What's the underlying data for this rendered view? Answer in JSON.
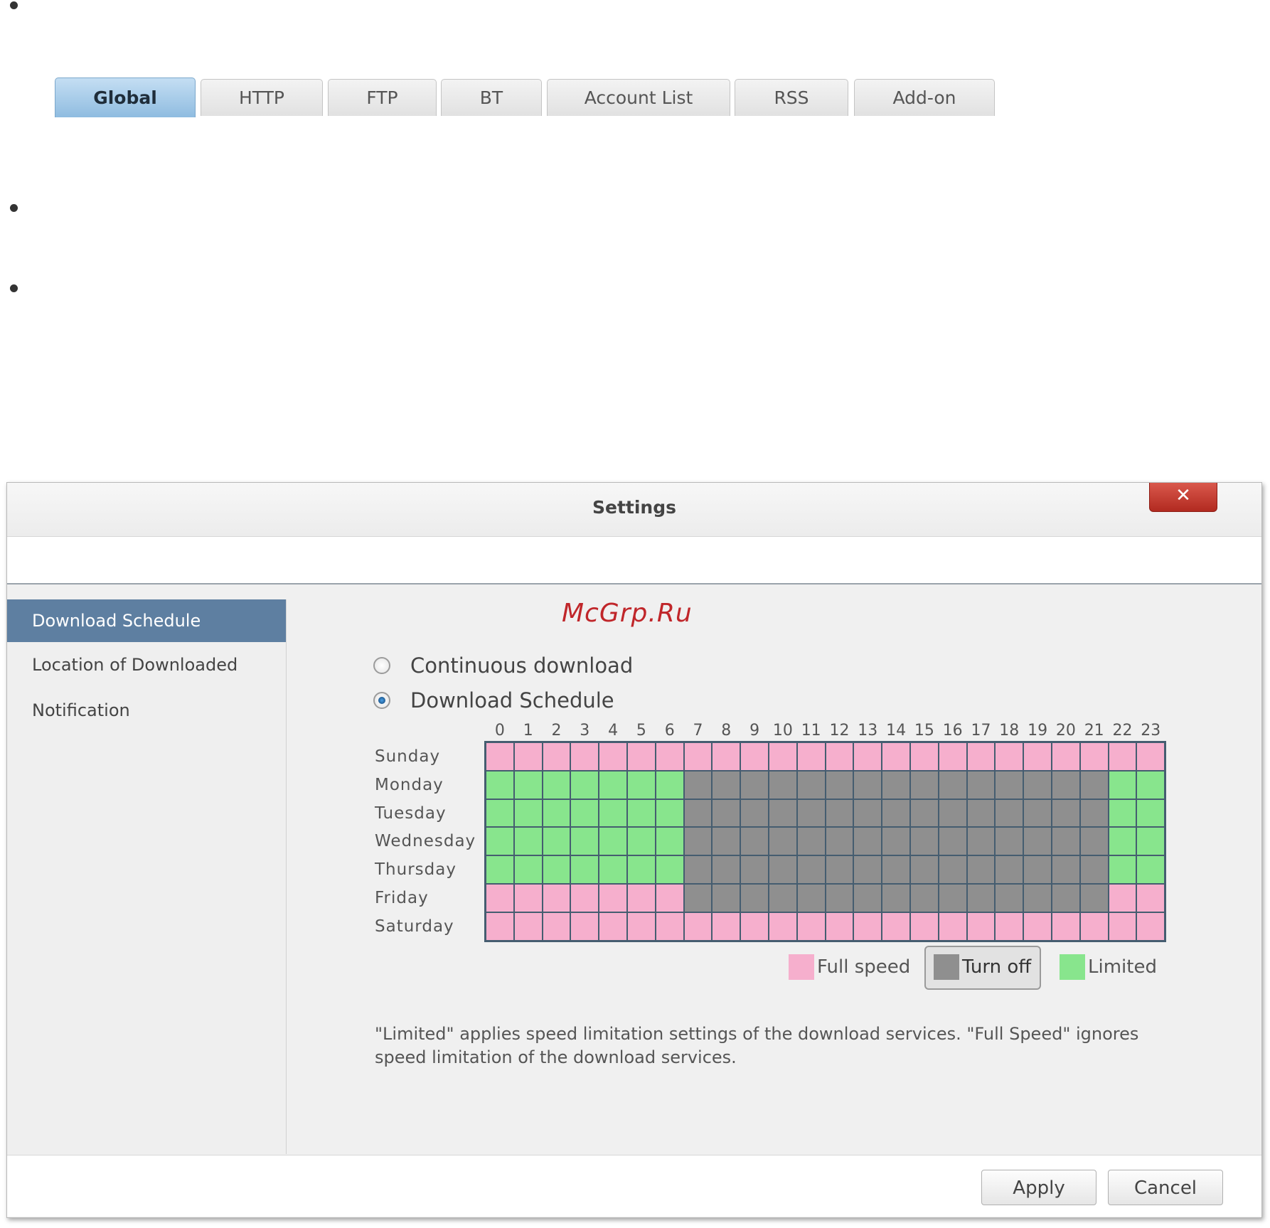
{
  "dialog": {
    "title": "Settings",
    "close_icon": "close-icon",
    "close_label": "✕"
  },
  "tabs": [
    {
      "label": "Global",
      "active": true
    },
    {
      "label": "HTTP",
      "active": false
    },
    {
      "label": "FTP",
      "active": false
    },
    {
      "label": "BT",
      "active": false
    },
    {
      "label": "Account List",
      "active": false
    },
    {
      "label": "RSS",
      "active": false
    },
    {
      "label": "Add-on",
      "active": false
    }
  ],
  "sidebar": {
    "items": [
      {
        "label": "Download Schedule",
        "active": true
      },
      {
        "label": "Location of Downloaded",
        "active": false
      },
      {
        "label": "Notification",
        "active": false
      }
    ]
  },
  "watermark": "McGrp.Ru",
  "download_mode": {
    "options": [
      {
        "label": "Continuous download",
        "checked": false
      },
      {
        "label": "Download Schedule",
        "checked": true
      }
    ]
  },
  "schedule": {
    "hours": [
      "0",
      "1",
      "2",
      "3",
      "4",
      "5",
      "6",
      "7",
      "8",
      "9",
      "10",
      "11",
      "12",
      "13",
      "14",
      "15",
      "16",
      "17",
      "18",
      "19",
      "20",
      "21",
      "22",
      "23"
    ],
    "days": [
      "Sunday",
      "Monday",
      "Tuesday",
      "Wednesday",
      "Thursday",
      "Friday",
      "Saturday"
    ],
    "grid": [
      "FFFFFFFFFFFFFFFFFFFFFFFF",
      "LLLLLLLOOOOOOOOOOOOOOOLL",
      "LLLLLLLOOOOOOOOOOOOOOOLL",
      "LLLLLLLOOOOOOOOOOOOOOOLL",
      "LLLLLLLOOOOOOOOOOOOOOOLL",
      "FFFFFFFOOOOOOOOOOOOOOOFF",
      "FFFFFFFFFFFFFFFFFFFFFFFF"
    ],
    "legend": {
      "F": {
        "label": "Full speed",
        "color": "#f6afcd"
      },
      "O": {
        "label": "Turn off",
        "color": "#8f8f8f"
      },
      "L": {
        "label": "Limited",
        "color": "#88e58d"
      }
    },
    "selected_brush": "Turn off",
    "grid_line_color": "#455d70"
  },
  "note": "\"Limited\" applies speed limitation settings of the download services. \"Full Speed\" ignores speed limitation of the download services.",
  "footer": {
    "apply_label": "Apply",
    "cancel_label": "Cancel"
  }
}
